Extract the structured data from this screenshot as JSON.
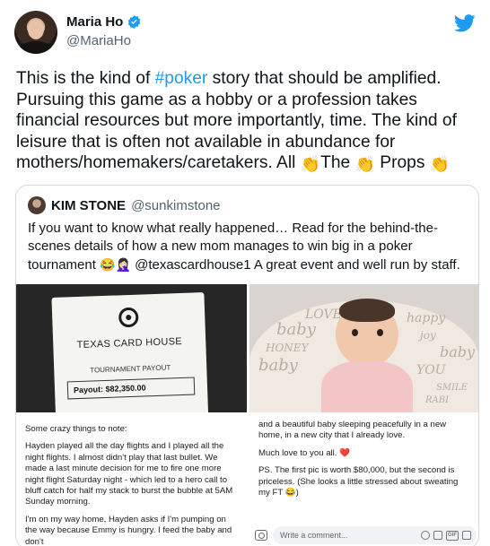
{
  "author": {
    "name": "Maria Ho",
    "handle": "@MariaHo"
  },
  "tweet": {
    "text_before": "This is the kind of ",
    "hashtag": "#poker",
    "text_after": " story that should be amplified. Pursuing this game as a hobby or a profession takes financial resources but more importantly, time. The kind of leisure  that is often not available in abundance for mothers/homemakers/caretakers. All ",
    "word_1": "The ",
    "word_2": " Props ",
    "clap": "👏"
  },
  "quoted": {
    "name": "KIM STONE",
    "handle": "@sunkimstone",
    "text_1": "If you want to know what really happened… Read for the behind-the-scenes details of how a new mom manages to win big in a poker tournament ",
    "emoji_1": "😂🤦🏻‍♀️",
    "text_2": " @texascardhouse1 A great event and well run by staff.",
    "ticket": {
      "title": "TEXAS CARD HOUSE",
      "subtitle": "TOURNAMENT PAYOUT",
      "payout_label": "Payout:",
      "payout_value": "$82,350.00"
    },
    "baby_photo": {
      "pillow_words": [
        "LOVE",
        "baby",
        "HONEY",
        "baby",
        "happy",
        "joy",
        "baby",
        "YOU",
        "SMILE",
        "RABI"
      ]
    },
    "doc_left": [
      "Some crazy things to note:",
      "Hayden played all the day flights and I played all the night flights. I almost didn't play that last bullet. We made a last minute decision for me to fire one more night flight Saturday night - which led to a hero call to bluff catch for half my stack to burst the bubble at 5AM Sunday morning.",
      "I'm on my way home, Hayden asks if I'm pumping on the way because Emmy is hungry. I feed the baby and don't"
    ],
    "doc_right": [
      "and a beautiful baby sleeping peacefully in a new home, in a new city that I already love.",
      "Much love to you all. ❤️",
      "PS. The first pic is worth $80,000, but the second is priceless. ",
      "(She looks a little stressed about sweating my FT 😂)"
    ],
    "comment_placeholder": "Write a comment...",
    "gif_label": "GIF"
  },
  "colors": {
    "link": "#1d9bf0",
    "text": "#0f1419",
    "muted": "#536471",
    "border": "#cfd9de"
  },
  "icons": [
    "verified-badge-icon",
    "twitter-bird-icon",
    "camera-icon",
    "emoji-icon",
    "gif-icon",
    "sticker-icon"
  ]
}
